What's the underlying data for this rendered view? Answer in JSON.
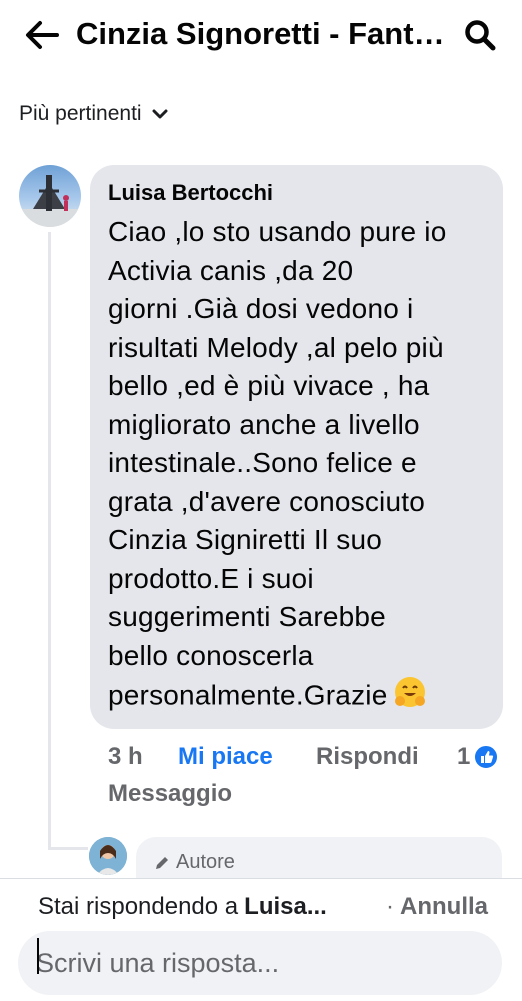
{
  "header": {
    "title": "Cinzia Signoretti - Fantasy Dog",
    "back_icon": "arrow-left-icon",
    "search_icon": "search-icon"
  },
  "sort": {
    "label": "Più pertinenti",
    "icon": "chevron-down-icon"
  },
  "comment": {
    "author": "Luisa Bertocchi",
    "text": "Ciao ,lo sto usando pure io\nActivia canis ,da 20\ngiorni .Già  dosi vedono i\nrisultati Melody ,al pelo più\nbello ,ed è  più  vivace , ha\nmigliorato anche a livello\nintestinale..Sono  felice e\ngrata ,d'avere  conosciuto\nCinzia  Signiretti Il suo\nprodotto.E i suoi\nsuggerimenti Sarebbe\nbello conoscerla\npersonalmente.Grazie",
    "emoji": "hugging-face-emoji",
    "time": "3 h",
    "like_label": "Mi piace",
    "reply_label": "Rispondi",
    "reaction_count": "1",
    "message_label": "Messaggio"
  },
  "reply_preview": {
    "badge": "Autore",
    "icon": "pencil-icon"
  },
  "composer": {
    "replying_prefix": "Stai rispondendo a",
    "replying_name": "Luisa...",
    "cancel_label": "Annulla",
    "placeholder": "Scrivi una risposta..."
  },
  "colors": {
    "link_blue": "#1877f2",
    "bubble": "#e4e6eb",
    "muted": "#65676b"
  }
}
